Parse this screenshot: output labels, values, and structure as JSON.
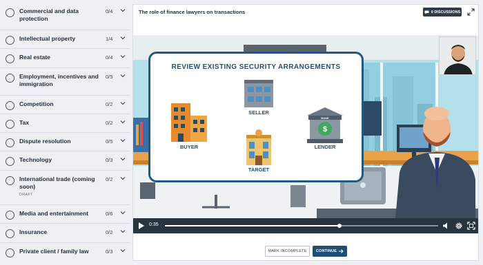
{
  "sidebar": {
    "items": [
      {
        "title": "Commercial and data protection",
        "count": "0/4"
      },
      {
        "title": "Intellectual property",
        "count": "1/4"
      },
      {
        "title": "Real estate",
        "count": "0/4"
      },
      {
        "title": "Employment, incentives and immigration",
        "count": "0/5"
      },
      {
        "title": "Competition",
        "count": "0/2"
      },
      {
        "title": "Tax",
        "count": "0/2"
      },
      {
        "title": "Dispute resolution",
        "count": "0/5"
      },
      {
        "title": "Technology",
        "count": "0/3"
      },
      {
        "title": "International trade (coming soon)",
        "count": "0/2",
        "sub": "DRAFT"
      },
      {
        "title": "Media and entertainment",
        "count": "0/6"
      },
      {
        "title": "Insurance",
        "count": "0/2"
      },
      {
        "title": "Private client / family law",
        "count": "0/3"
      }
    ]
  },
  "main": {
    "lesson_title": "The role of finance lawyers on transactions",
    "discussions_label": "0 DISCUSSIONS"
  },
  "video": {
    "slide_title": "REVIEW EXISTING SECURITY ARRANGEMENTS",
    "labels": {
      "buyer": "BUYER",
      "seller": "SELLER",
      "target": "TARGET",
      "lender": "LENDER"
    },
    "bank_sign": "BANK",
    "current_time": "0:35",
    "progress_fraction": 0.64
  },
  "footer": {
    "mark_incomplete_label": "MARK INCOMPLETE",
    "continue_label": "CONTINUE"
  },
  "colors": {
    "accent": "#1c4e76",
    "slide_text": "#1f4f7a"
  }
}
